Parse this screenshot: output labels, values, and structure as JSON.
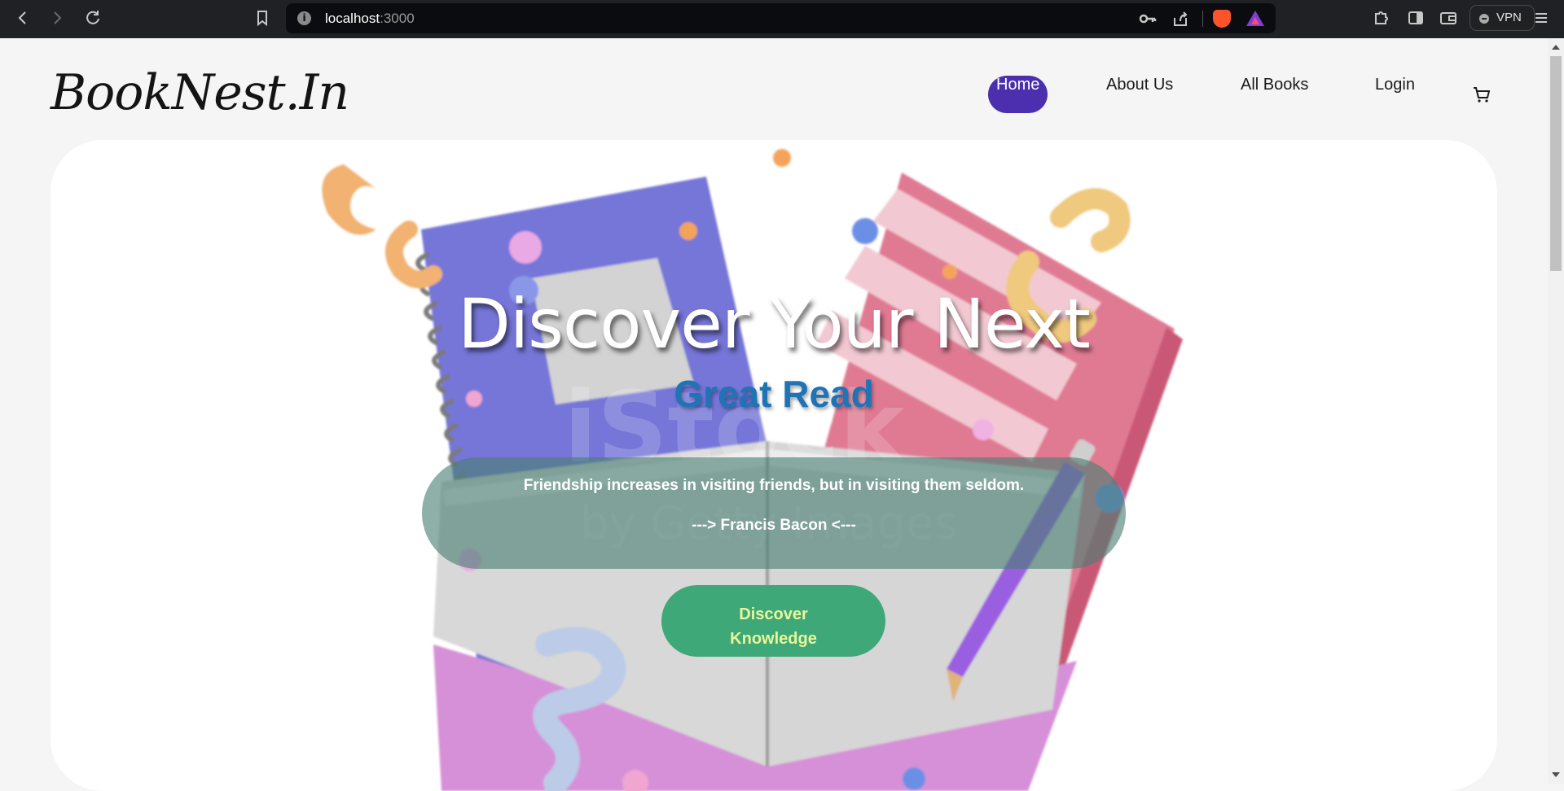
{
  "browser": {
    "url_host": "localhost",
    "url_port": ":3000",
    "vpn_label": "VPN"
  },
  "site": {
    "logo": "BookNest.In",
    "nav": [
      {
        "label": "Home",
        "active": true
      },
      {
        "label": "About Us",
        "active": false
      },
      {
        "label": "All Books",
        "active": false
      },
      {
        "label": "Login",
        "active": false
      }
    ]
  },
  "hero": {
    "title_line1": "Discover Your Next",
    "title_line2": "Great Read",
    "quote": "Friendship increases in visiting friends, but in visiting them seldom.",
    "author": "---> Francis Bacon <---",
    "cta_line1": "Discover",
    "cta_line2": "Knowledge"
  },
  "colors": {
    "nav_active_bg": "#4b2fae",
    "cta_bg": "#3fa878",
    "cta_text": "#e9f79a",
    "title2": "#1f74b6",
    "quote_box": "#498073"
  },
  "icons": [
    "back-icon",
    "forward-icon",
    "reload-icon",
    "bookmark-icon",
    "info-icon",
    "key-icon",
    "share-icon",
    "brave-shield-icon",
    "brave-rewards-icon",
    "extensions-icon",
    "sidebar-icon",
    "wallet-icon",
    "vpn-icon",
    "menu-icon",
    "cart-icon"
  ]
}
